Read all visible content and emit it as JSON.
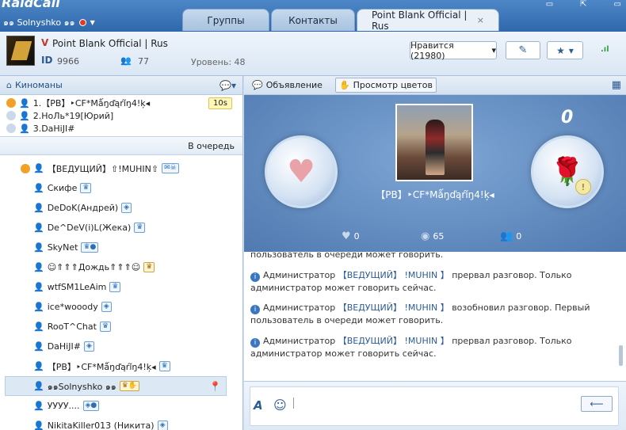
{
  "app": {
    "logo_text": "RaidCall"
  },
  "user": {
    "name": "๑๑ Solnyshko ๑๑"
  },
  "tabs": [
    {
      "label": "Группы"
    },
    {
      "label": "Контакты"
    },
    {
      "label": "Point Blank Official | Rus",
      "close": "×"
    }
  ],
  "room": {
    "v_mark": "V",
    "name": "Point Blank Official | Rus",
    "id_label": "ID",
    "id_value": "9966",
    "users_count": "77",
    "level": "Уровень: 48",
    "like_label": "Нравится (21980)",
    "like_caret": "▾",
    "fav_caret": "▾"
  },
  "group": {
    "name": "Киноманы",
    "menu_caret": "▾"
  },
  "queue": {
    "timer": "10s",
    "rows": [
      "1.【PB】‣CF*Mǻŋďąŕǐŋ4!ķ◂",
      "2.НоЛь*19[Юрий]",
      "3.DaHiJI#"
    ],
    "button_label": "В очередь"
  },
  "members": [
    {
      "name": "【ВЕДУЩИЙ】⇧!MUHIN⇧",
      "badge": "✉☠",
      "host": true
    },
    {
      "name": "Скифе",
      "badge": "♛"
    },
    {
      "name": "DeDoK(Андрей)",
      "badge": "◈"
    },
    {
      "name": "De^DeV(i)L(Жека)",
      "badge": "♛"
    },
    {
      "name": "SkyNet",
      "badge": "♛●"
    },
    {
      "name": "☺⇑⇑⇑Дождь⇑⇑⇑☺",
      "badge": "♛",
      "gold": true
    },
    {
      "name": "wtfSM1LeAim",
      "badge": "♛"
    },
    {
      "name": "ice*wooody",
      "badge": "◈"
    },
    {
      "name": "RooT^Chat",
      "badge": "♛"
    },
    {
      "name": "DaHiJI#",
      "badge": "◈"
    },
    {
      "name": "【PB】‣CF*Mǻŋďąŕǐŋ4!ķ◂",
      "badge": "♛"
    },
    {
      "name": "๑๑Solnyshko ๑๑",
      "badge": "♛✋",
      "gold": true,
      "selected": true
    },
    {
      "name": "УУУУ....",
      "badge": "◈●"
    },
    {
      "name": "NikitaKiller013 (Никита)",
      "badge": "◈"
    }
  ],
  "toolbar": {
    "announcement": "Объявление",
    "view_colors": "Просмотр цветов"
  },
  "stage": {
    "score": "0",
    "speaker_name": "【PB】‣CF*Mǻŋďąŕǐŋ4!ķ◂",
    "likes": "0",
    "views": "65",
    "listeners": "0"
  },
  "messages": [
    {
      "parts": [
        "пользователь в очереди может говорить."
      ]
    },
    {
      "parts": [
        "Администратор ",
        "【ВЕДУЩИЙ】 !MUHIN 】",
        " прервал разговор. Только администратор может говорить сейчас."
      ]
    },
    {
      "parts": [
        "Администратор ",
        "【ВЕДУЩИЙ】 !MUHIN 】",
        " возобновил разговор. Первый пользователь в очереди может говорить."
      ]
    },
    {
      "parts": [
        "Администратор ",
        "【ВЕДУЩИЙ】 !MUHIN 】",
        " прервал разговор. Только администратор может говорить сейчас."
      ]
    }
  ],
  "composer": {
    "send_label": "⟵"
  },
  "colors": {
    "accent": "#2f68ab",
    "panel": "#dbe7f4",
    "stage": "#5f88bf"
  }
}
